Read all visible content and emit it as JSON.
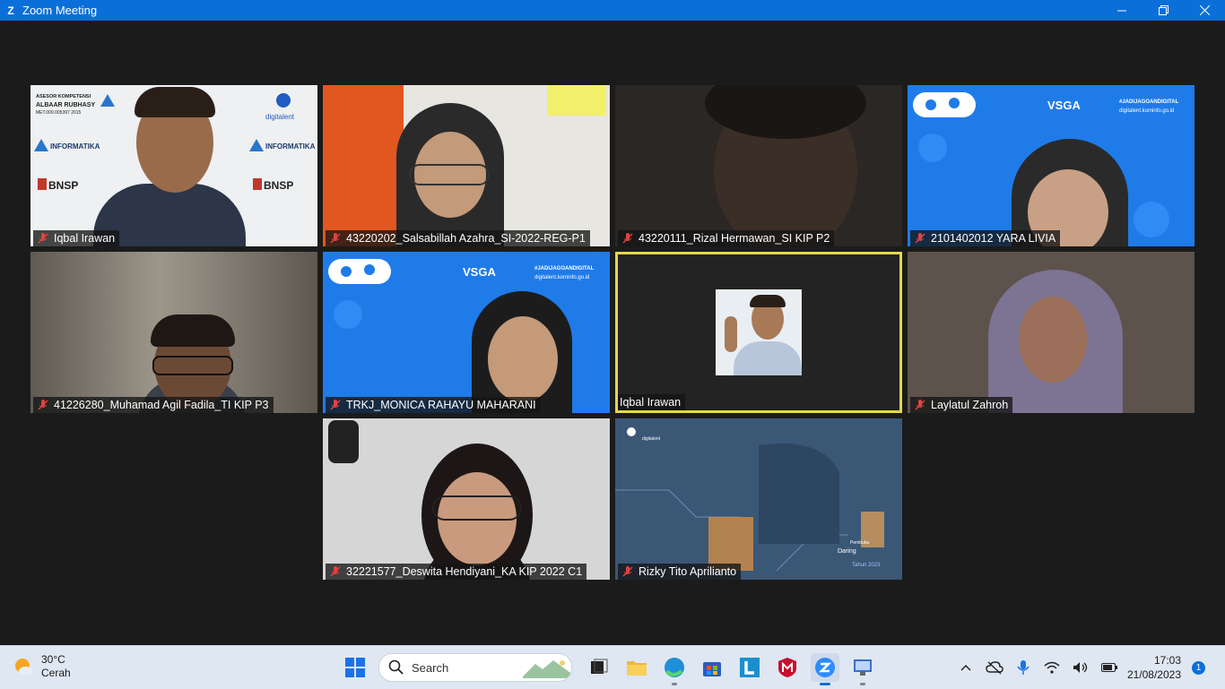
{
  "window": {
    "title": "Zoom Meeting",
    "logo_letter": "Z",
    "controls": [
      "minimize",
      "maximize",
      "close"
    ]
  },
  "tiles": [
    {
      "name": "Iqbal Irawan",
      "muted": true,
      "bg": "#e9ecef",
      "branding": {
        "l1": "ASESOR KOMPETENSI",
        "l2": "ALBAAR RUBHASY",
        "l3": "MET.000.005397 2015",
        "informatika": "INFORMATIKA",
        "bnsp": "BNSP",
        "digitalent": "digitalent"
      }
    },
    {
      "name": "43220202_Salsabillah Azahra_SI-2022-REG-P1",
      "muted": true,
      "bg": "#d8d6d0"
    },
    {
      "name": "43220111_Rizal Hermawan_SI KIP P2",
      "muted": true,
      "bg": "#2c2a28"
    },
    {
      "name": "2101402012 YARA LIVIA",
      "muted": true,
      "bg": "#1f7be8",
      "branding": {
        "vsga": "VSGA",
        "hashtag": "#JADIJAGOANDIGITAL",
        "site": "digitalent.kominfo.go.id",
        "digitalent": "digitalent"
      }
    },
    {
      "name": "41226280_Muhamad Agil Fadila_TI KIP P3",
      "muted": true,
      "bg": "#6f6a62"
    },
    {
      "name": "TRKJ_MONICA RAHAYU MAHARANI",
      "muted": true,
      "bg": "#1f7be8",
      "branding": {
        "vsga": "VSGA",
        "hashtag": "#JADIJAGOANDIGITAL",
        "site": "digitalent.kominfo.go.id",
        "digitalent": "digitalent"
      }
    },
    {
      "name": "Iqbal Irawan",
      "muted": false,
      "bg": "#232323",
      "active": true
    },
    {
      "name": "Laylatul Zahroh",
      "muted": true,
      "bg": "#5a4f49"
    },
    {
      "name": "32221577_Deswita Hendiyani_KA KIP 2022 C1",
      "muted": true,
      "bg": "#cfcfcf"
    },
    {
      "name": "Rizky Tito Aprilianto",
      "muted": true,
      "bg": "#3d5a80",
      "branding": {
        "digitalent": "digitalent",
        "line1": "Pembuka",
        "line2": "Daring",
        "year": "Tahun 2023"
      }
    }
  ],
  "taskbar": {
    "weather": {
      "temp": "30°C",
      "condition": "Cerah",
      "icon": "sun-cloud-icon"
    },
    "search": {
      "placeholder": "Search"
    },
    "apps": [
      "file-explorer-icon",
      "edge-icon",
      "store-icon",
      "l-app-icon",
      "mcafee-icon",
      "zoom-icon",
      "remote-desktop-icon"
    ],
    "clock": {
      "time": "17:03",
      "date": "21/08/2023"
    },
    "notifications": "1"
  },
  "colors": {
    "titlebar": "#0b6fd9",
    "active_speaker": "#e4d84a",
    "meeting_bg": "#1b1b1b",
    "taskbar": "#dfe7f2"
  }
}
